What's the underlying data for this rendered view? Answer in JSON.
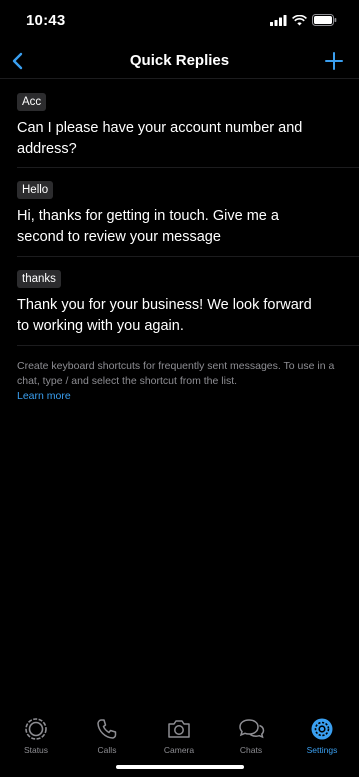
{
  "status": {
    "time": "10:43"
  },
  "nav": {
    "title": "Quick Replies"
  },
  "replies": [
    {
      "shortcut": "Acc",
      "message": "Can I please have your account number and address?"
    },
    {
      "shortcut": "Hello",
      "message": "Hi, thanks for getting in touch. Give me a second to review your message"
    },
    {
      "shortcut": "thanks",
      "message": "Thank you for your business! We look forward to working with you again."
    }
  ],
  "footer": {
    "text": "Create keyboard shortcuts for frequently sent messages. To use in a chat, type / and select the shortcut from the list.",
    "link": "Learn more"
  },
  "tabs": [
    {
      "label": "Status",
      "icon": "status-icon"
    },
    {
      "label": "Calls",
      "icon": "phone-icon"
    },
    {
      "label": "Camera",
      "icon": "camera-icon"
    },
    {
      "label": "Chats",
      "icon": "chats-icon"
    },
    {
      "label": "Settings",
      "icon": "settings-icon",
      "active": true
    }
  ],
  "colors": {
    "accent": "#3a9ff0",
    "background": "#000000",
    "tag_bg": "#2c2c2e",
    "muted": "#8e8e93"
  }
}
